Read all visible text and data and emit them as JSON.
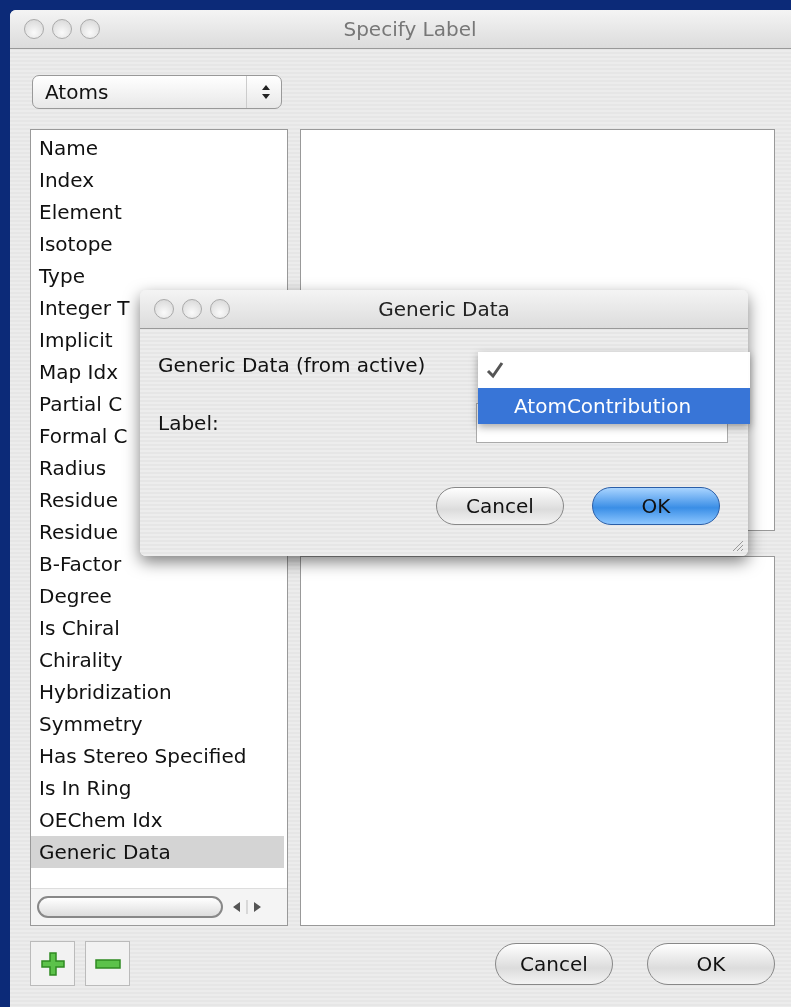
{
  "window": {
    "title": "Specify Label"
  },
  "category_popup": {
    "value": "Atoms"
  },
  "properties": [
    {
      "label": "Name",
      "selected": false
    },
    {
      "label": "Index",
      "selected": false
    },
    {
      "label": "Element",
      "selected": false
    },
    {
      "label": "Isotope",
      "selected": false
    },
    {
      "label": "Type",
      "selected": false
    },
    {
      "label": "Integer T",
      "selected": false
    },
    {
      "label": "Implicit",
      "selected": false
    },
    {
      "label": "Map Idx",
      "selected": false
    },
    {
      "label": "Partial C",
      "selected": false
    },
    {
      "label": "Formal C",
      "selected": false
    },
    {
      "label": "Radius",
      "selected": false
    },
    {
      "label": "Residue",
      "selected": false
    },
    {
      "label": "Residue",
      "selected": false
    },
    {
      "label": "B-Factor",
      "selected": false
    },
    {
      "label": "Degree",
      "selected": false
    },
    {
      "label": "Is Chiral",
      "selected": false
    },
    {
      "label": "Chirality",
      "selected": false
    },
    {
      "label": "Hybridization",
      "selected": false
    },
    {
      "label": "Symmetry",
      "selected": false
    },
    {
      "label": "Has Stereo Specified",
      "selected": false
    },
    {
      "label": "Is In Ring",
      "selected": false
    },
    {
      "label": "OEChem Idx",
      "selected": false
    },
    {
      "label": "Generic Data",
      "selected": true
    }
  ],
  "dialog": {
    "title": "Generic Data",
    "source_label": "Generic Data (from active)",
    "menu": [
      {
        "checked": true,
        "selected": false
      },
      {
        "label": "AtomContribution",
        "checked": false,
        "selected": true
      }
    ],
    "label_field_label": "Label:",
    "buttons": [
      {
        "label": "Cancel",
        "default": false
      },
      {
        "label": "OK",
        "default": true
      }
    ]
  },
  "buttons": [
    {
      "label": "Cancel",
      "default": false
    },
    {
      "label": "OK",
      "default": false
    }
  ]
}
